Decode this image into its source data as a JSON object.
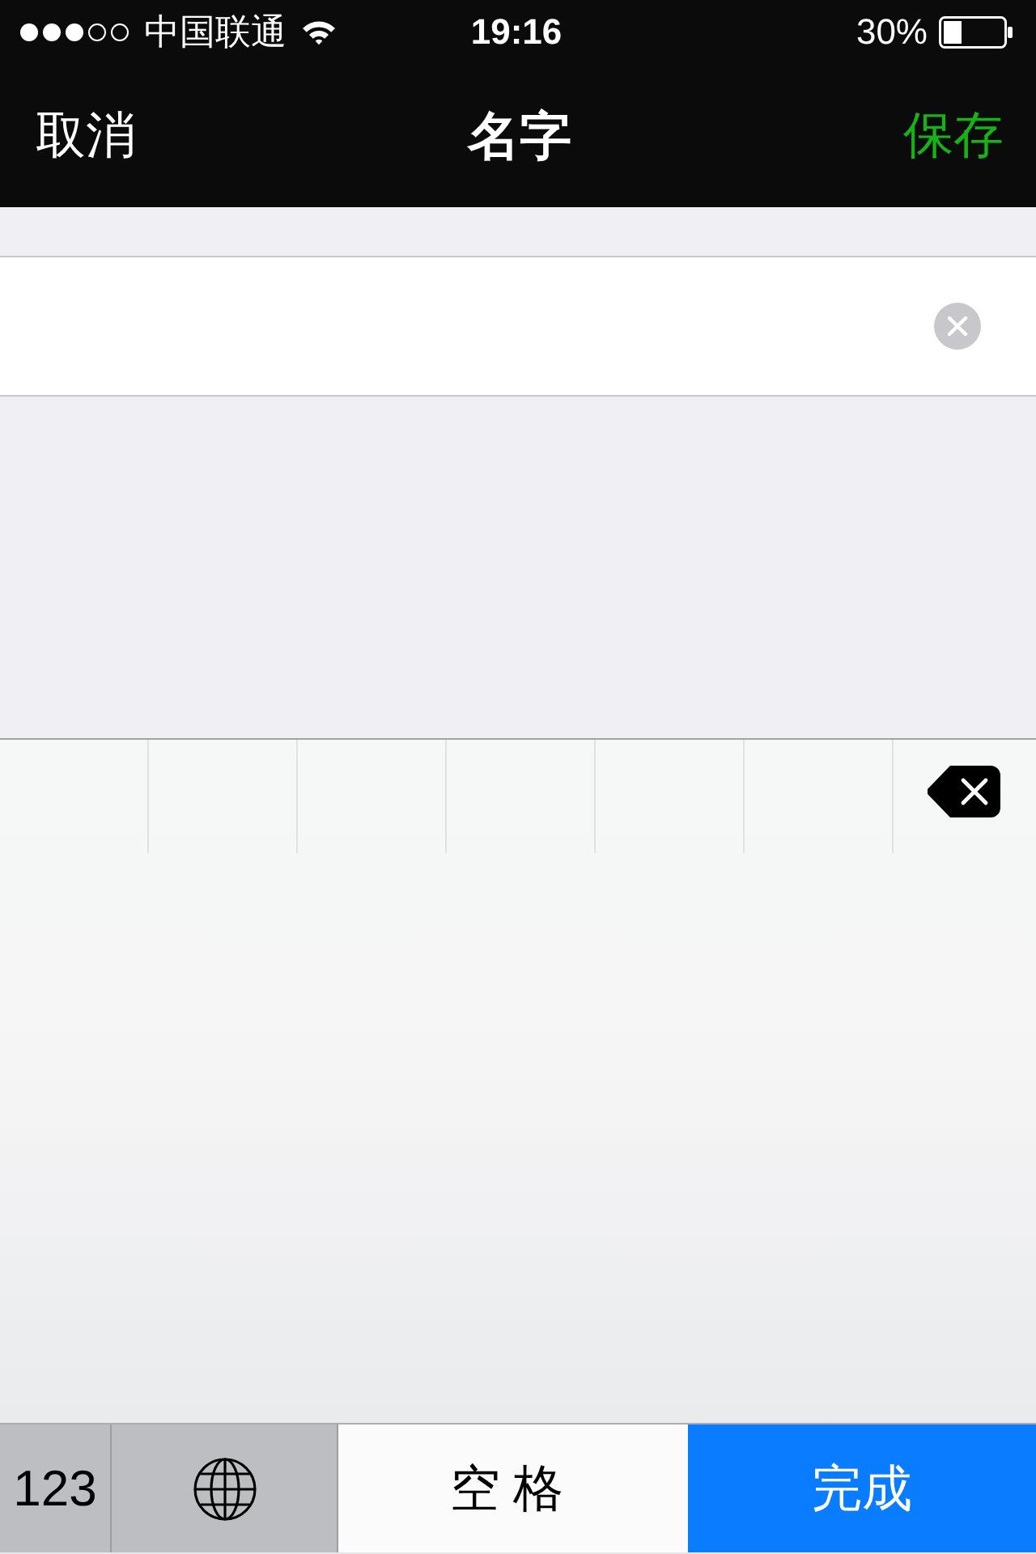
{
  "status_bar": {
    "carrier": "中国联通",
    "time": "19:16",
    "battery": "30%"
  },
  "nav_bar": {
    "left_button": "取消",
    "title": "名字",
    "right_button": "保存"
  },
  "name_field": {
    "clear_button": true
  },
  "keyboard": {
    "keys": [
      {
        "kind": "mode",
        "label": "123"
      },
      {
        "kind": "globe"
      },
      {
        "kind": "space",
        "label": "空格"
      },
      {
        "kind": "done",
        "label": "完成"
      }
    ]
  }
}
